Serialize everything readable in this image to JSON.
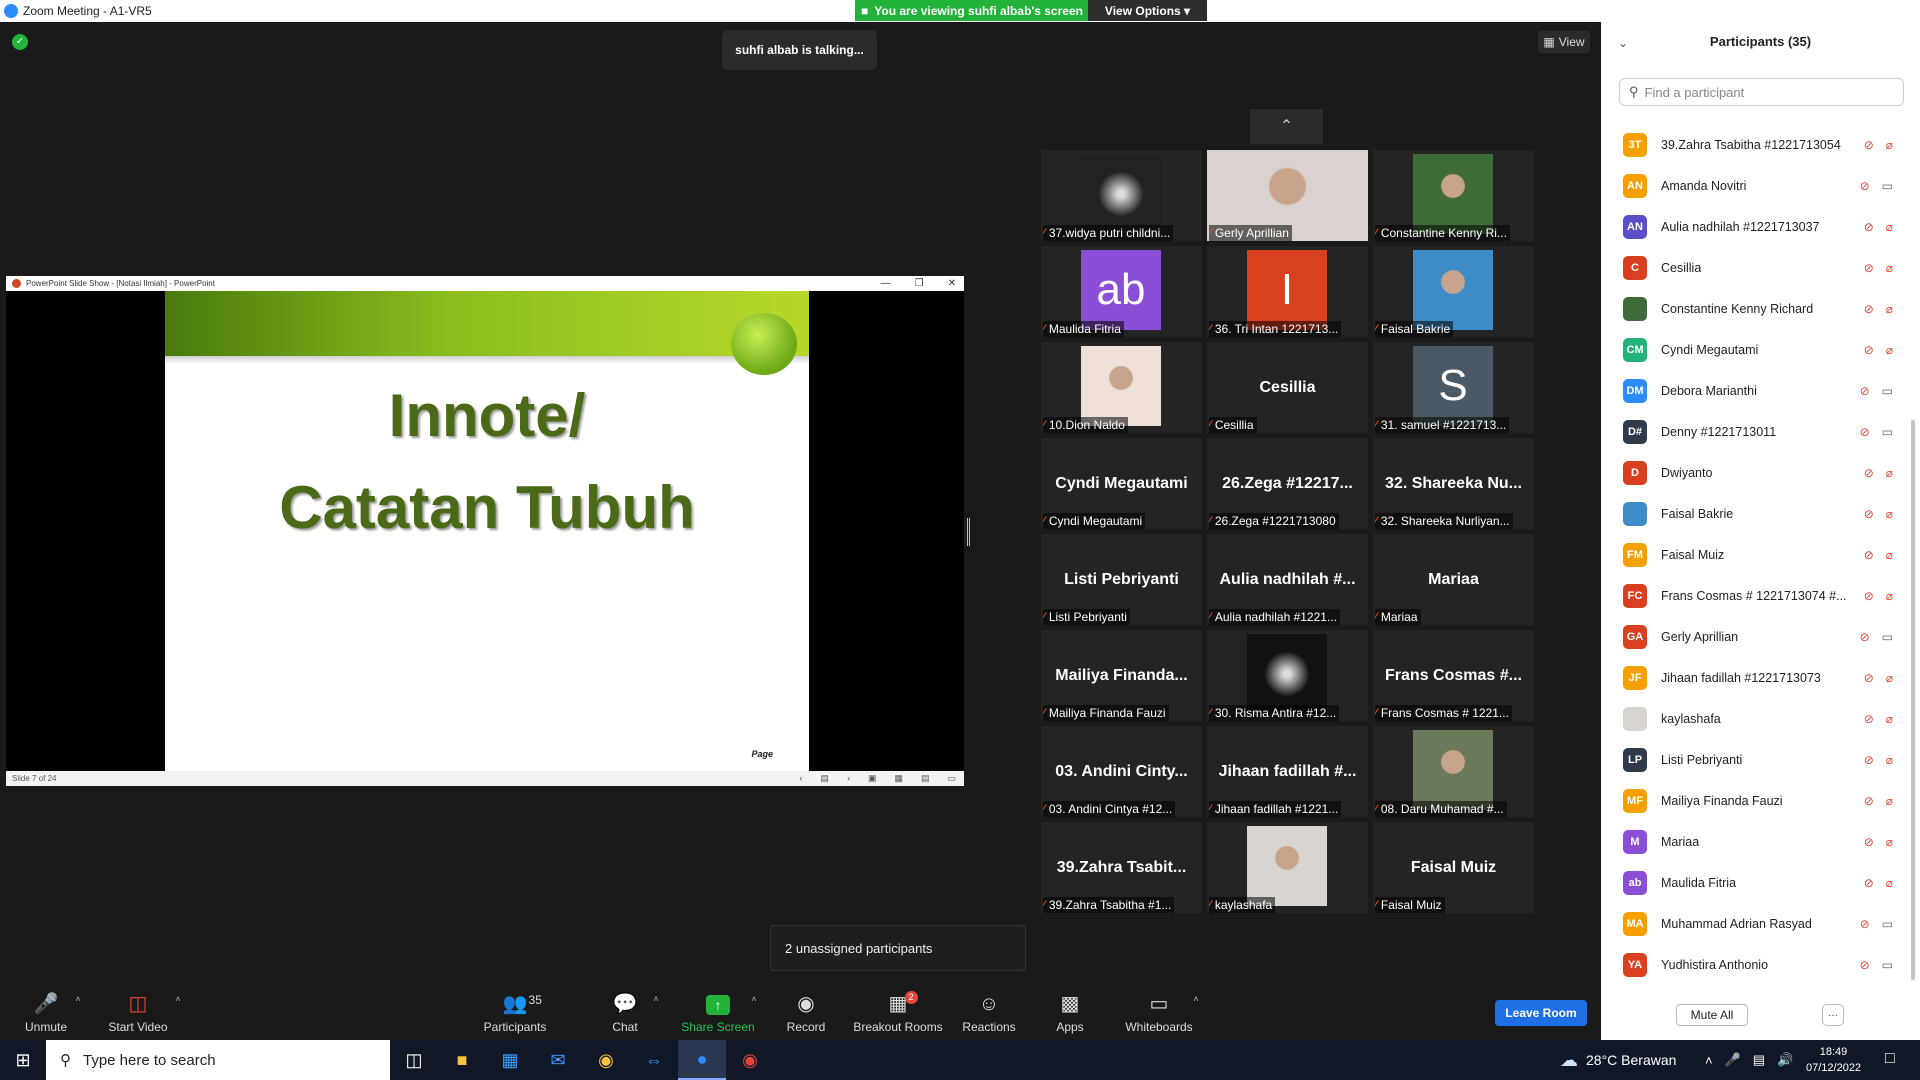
{
  "window": {
    "title": "Zoom Meeting - A1-VR5"
  },
  "banner": {
    "viewing": "You are viewing suhfi albab's screen",
    "view_options": "View Options"
  },
  "talking": "suhfi albab is talking...",
  "view_button": "View",
  "share": {
    "window_title": "PowerPoint Slide Show - [Notasi Ilmiah] - PowerPoint",
    "slide_title_1": "Innote/",
    "slide_title_2": "Catatan Tubuh",
    "page_label": "Page",
    "status": "Slide 7 of 24"
  },
  "tiles": [
    {
      "name": "",
      "label": "37.widya putri childni...",
      "kind": "image",
      "color": "#222"
    },
    {
      "name": "",
      "label": "Gerly Aprillian",
      "kind": "photo",
      "color": "#d9d2cf"
    },
    {
      "name": "",
      "label": "Constantine Kenny Ri...",
      "kind": "photo",
      "color": "#3f6a3a"
    },
    {
      "name": "",
      "label": "Maulida Fitria",
      "kind": "avatar",
      "avatar": "ab",
      "color": "#8a4fd6"
    },
    {
      "name": "",
      "label": "36. Tri Intan 1221713...",
      "kind": "avatar",
      "avatar": "I",
      "color": "#d9401f"
    },
    {
      "name": "",
      "label": "Faisal Bakrie",
      "kind": "photo",
      "color": "#3e8cc7"
    },
    {
      "name": "",
      "label": "10.Dion Naldo",
      "kind": "photo",
      "color": "#eee0d8"
    },
    {
      "name": "Cesillia",
      "label": "Cesillia",
      "kind": "name"
    },
    {
      "name": "",
      "label": "31. samuel #1221713...",
      "kind": "avatar",
      "avatar": "S",
      "color": "#4a5963"
    },
    {
      "name": "Cyndi Megautami",
      "label": "Cyndi Megautami",
      "kind": "name"
    },
    {
      "name": "26.Zega #12217...",
      "label": "26.Zega #1221713080",
      "kind": "name"
    },
    {
      "name": "32. Shareeka Nu...",
      "label": "32. Shareeka Nurliyan...",
      "kind": "name"
    },
    {
      "name": "Listi Pebriyanti",
      "label": "Listi Pebriyanti",
      "kind": "name"
    },
    {
      "name": "Aulia nadhilah #...",
      "label": "Aulia nadhilah #1221...",
      "kind": "name"
    },
    {
      "name": "Mariaa",
      "label": "Mariaa",
      "kind": "name"
    },
    {
      "name": "Mailiya Finanda...",
      "label": "Mailiya Finanda Fauzi",
      "kind": "name"
    },
    {
      "name": "",
      "label": "30. Risma Antira #12...",
      "kind": "image",
      "color": "#111"
    },
    {
      "name": "Frans Cosmas #...",
      "label": "Frans Cosmas # 1221...",
      "kind": "name"
    },
    {
      "name": "03. Andini Cinty...",
      "label": "03. Andini Cintya #12...",
      "kind": "name"
    },
    {
      "name": "Jihaan fadillah #...",
      "label": "Jihaan fadillah #1221...",
      "kind": "name"
    },
    {
      "name": "",
      "label": "08. Daru Muhamad #...",
      "kind": "photo",
      "color": "#6b7a5a"
    },
    {
      "name": "39.Zahra Tsabit...",
      "label": "39.Zahra Tsabitha #1...",
      "kind": "name"
    },
    {
      "name": "",
      "label": "kaylashafa",
      "kind": "photo",
      "color": "#d8d4d0"
    },
    {
      "name": "Faisal Muiz",
      "label": "Faisal Muiz",
      "kind": "name"
    }
  ],
  "unassigned": "2 unassigned participants",
  "toolbar": {
    "unmute": "Unmute",
    "start_video": "Start Video",
    "participants": "Participants",
    "participants_count": "35",
    "chat": "Chat",
    "share_screen": "Share Screen",
    "record": "Record",
    "breakout_rooms": "Breakout Rooms",
    "breakout_badge": "2",
    "reactions": "Reactions",
    "apps": "Apps",
    "whiteboards": "Whiteboards",
    "leave_room": "Leave Room"
  },
  "panel": {
    "title": "Participants (35)",
    "search_placeholder": "Find a participant",
    "mute_all": "Mute All",
    "more": "···",
    "participants": [
      {
        "initials": "3T",
        "name": "39.Zahra Tsabitha #1221713054",
        "color": "#f5a000",
        "video": false
      },
      {
        "initials": "AN",
        "name": "Amanda Novitri",
        "color": "#f5a000",
        "video": true
      },
      {
        "initials": "AN",
        "name": "Aulia nadhilah #1221713037",
        "color": "#5b4fc9",
        "video": false
      },
      {
        "initials": "C",
        "name": "Cesillia",
        "color": "#d9401f",
        "video": false
      },
      {
        "initials": "",
        "name": "Constantine Kenny Richard",
        "color": "#3f6a3a",
        "video": false
      },
      {
        "initials": "CM",
        "name": "Cyndi Megautami",
        "color": "#23b37a",
        "video": false
      },
      {
        "initials": "DM",
        "name": "Debora Marianthi",
        "color": "#2d8cff",
        "video": true
      },
      {
        "initials": "D#",
        "name": "Denny #1221713011",
        "color": "#2f3a4a",
        "video": true
      },
      {
        "initials": "D",
        "name": "Dwiyanto",
        "color": "#d9401f",
        "video": false
      },
      {
        "initials": "",
        "name": "Faisal Bakrie",
        "color": "#3e8cc7",
        "video": false
      },
      {
        "initials": "FM",
        "name": "Faisal Muiz",
        "color": "#f5a000",
        "video": false
      },
      {
        "initials": "FC",
        "name": "Frans Cosmas # 1221713074 #...",
        "color": "#d9401f",
        "video": false
      },
      {
        "initials": "GA",
        "name": "Gerly Aprillian",
        "color": "#d9401f",
        "video": true
      },
      {
        "initials": "JF",
        "name": "Jihaan fadillah #1221713073",
        "color": "#f5a000",
        "video": false
      },
      {
        "initials": "",
        "name": "kaylashafa",
        "color": "#d8d4d0",
        "video": false
      },
      {
        "initials": "LP",
        "name": "Listi Pebriyanti",
        "color": "#2f3a4a",
        "video": false
      },
      {
        "initials": "MF",
        "name": "Mailiya Finanda Fauzi",
        "color": "#f5a000",
        "video": false
      },
      {
        "initials": "M",
        "name": "Mariaa",
        "color": "#8a4fd6",
        "video": false
      },
      {
        "initials": "ab",
        "name": "Maulida Fitria",
        "color": "#8a4fd6",
        "video": false
      },
      {
        "initials": "MA",
        "name": "Muhammad Adrian Rasyad",
        "color": "#f5a000",
        "video": true
      },
      {
        "initials": "YA",
        "name": "Yudhistira Anthonio",
        "color": "#d9401f",
        "video": true
      }
    ]
  },
  "taskbar": {
    "search_placeholder": "Type here to search",
    "weather": "28°C  Berawan",
    "time": "18:49",
    "date": "07/12/2022"
  }
}
